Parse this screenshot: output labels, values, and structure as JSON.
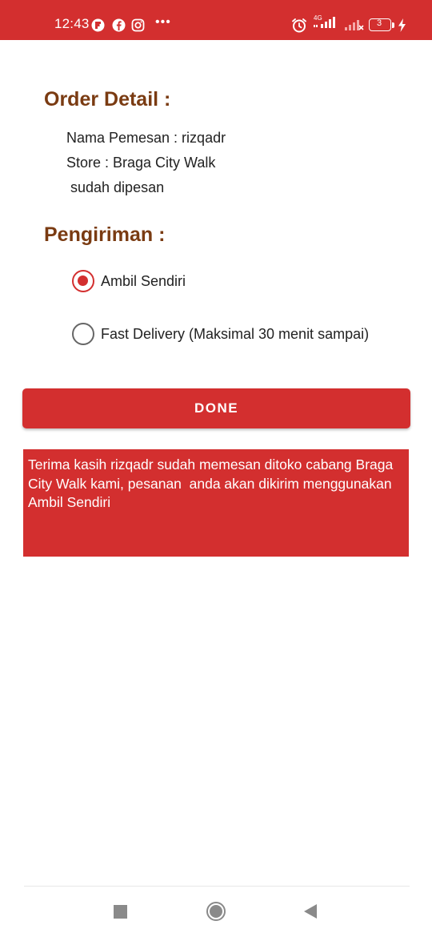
{
  "status_bar": {
    "time": "12:43",
    "network_label": "4G",
    "battery_level": "3"
  },
  "order_detail": {
    "title": "Order Detail :",
    "customer_line": "Nama Pemesan : rizqadr",
    "store_line": "Store : Braga City Walk",
    "status_line": " sudah dipesan"
  },
  "shipping": {
    "title": "Pengiriman :",
    "options": [
      {
        "label": "Ambil Sendiri",
        "selected": true
      },
      {
        "label": "Fast Delivery (Maksimal 30 menit sampai)",
        "selected": false
      }
    ]
  },
  "done_label": "DONE",
  "message": "Terima kasih rizqadr sudah memesan ditoko cabang Braga City Walk kami, pesanan  anda akan dikirim menggunakan Ambil Sendiri",
  "colors": {
    "primary": "#d32f2f",
    "heading": "#7a3b12"
  }
}
